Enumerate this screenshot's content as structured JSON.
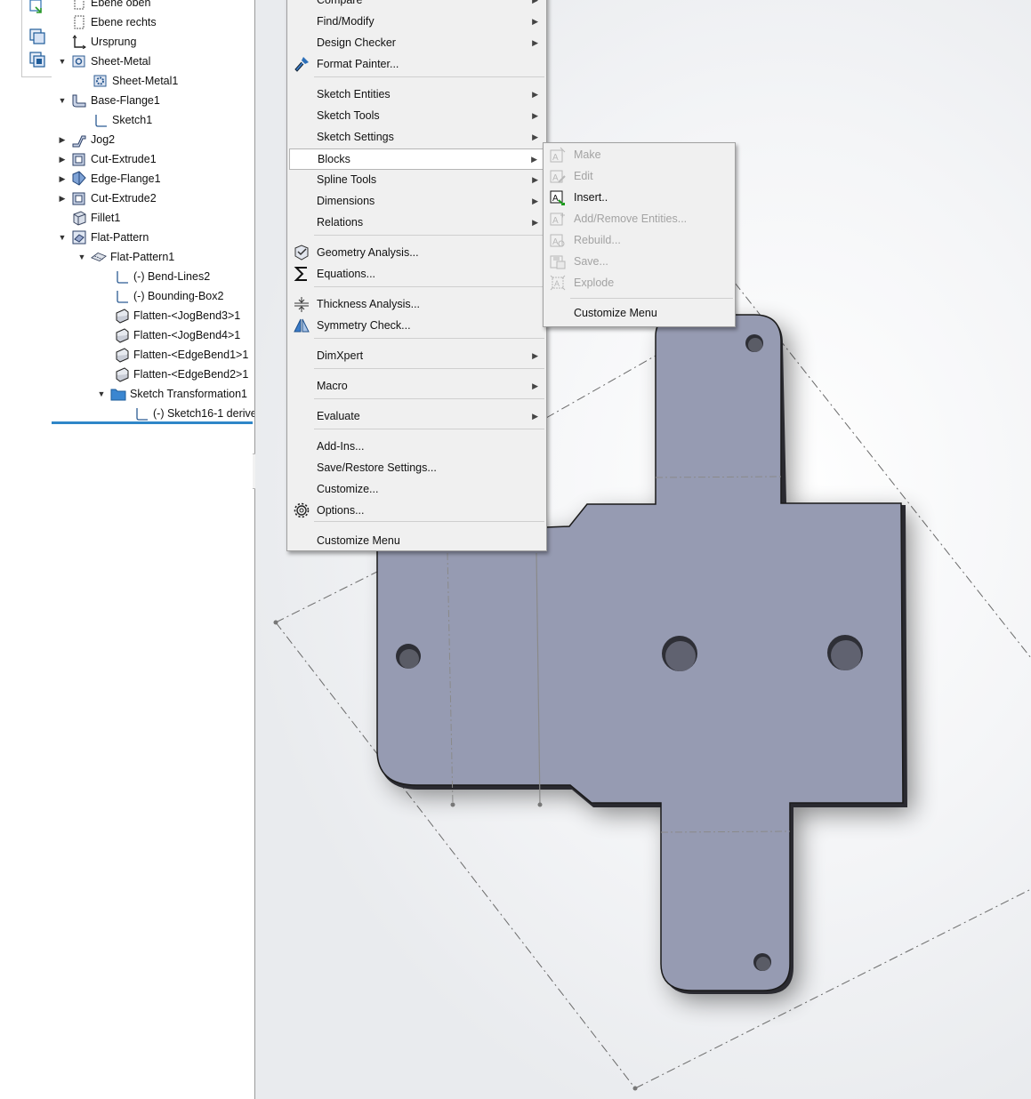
{
  "tree": {
    "items": [
      {
        "label": "Ebene oben",
        "icon": "plane-icon"
      },
      {
        "label": "Ebene rechts",
        "icon": "plane-icon"
      },
      {
        "label": "Ursprung",
        "icon": "origin-icon"
      },
      {
        "label": "Sheet-Metal",
        "icon": "sheet-metal-icon"
      },
      {
        "label": "Sheet-Metal1",
        "icon": "sheet-metal-gear-icon"
      },
      {
        "label": "Base-Flange1",
        "icon": "base-flange-icon"
      },
      {
        "label": "Sketch1",
        "icon": "sketch-icon"
      },
      {
        "label": "Jog2",
        "icon": "jog-icon"
      },
      {
        "label": "Cut-Extrude1",
        "icon": "cut-extrude-icon"
      },
      {
        "label": "Edge-Flange1",
        "icon": "edge-flange-icon"
      },
      {
        "label": "Cut-Extrude2",
        "icon": "cut-extrude-icon"
      },
      {
        "label": "Fillet1",
        "icon": "fillet-icon"
      },
      {
        "label": "Flat-Pattern",
        "icon": "flat-pattern-folder-icon"
      },
      {
        "label": "Flat-Pattern1",
        "icon": "flat-pattern-icon"
      },
      {
        "label": "(-) Bend-Lines2",
        "icon": "sketch-icon"
      },
      {
        "label": "(-) Bounding-Box2",
        "icon": "sketch-icon"
      },
      {
        "label": "Flatten-<JogBend3>1",
        "icon": "flatten-bend-icon"
      },
      {
        "label": "Flatten-<JogBend4>1",
        "icon": "flatten-bend-icon"
      },
      {
        "label": "Flatten-<EdgeBend1>1",
        "icon": "flatten-bend-icon"
      },
      {
        "label": "Flatten-<EdgeBend2>1",
        "icon": "flatten-bend-icon"
      },
      {
        "label": "Sketch Transformation1",
        "icon": "folder-icon"
      },
      {
        "label": "(-) Sketch16-1 derive",
        "icon": "sketch-icon"
      }
    ]
  },
  "menu": {
    "items": [
      {
        "label": "Compare",
        "arrow": true
      },
      {
        "label": "Find/Modify",
        "arrow": true
      },
      {
        "label": "Design Checker",
        "arrow": true
      },
      {
        "label": "Format Painter...",
        "arrow": false,
        "icon": "format-painter-icon"
      },
      {
        "label": "Sketch Entities",
        "arrow": true
      },
      {
        "label": "Sketch Tools",
        "arrow": true
      },
      {
        "label": "Sketch Settings",
        "arrow": true
      },
      {
        "label": "Blocks",
        "arrow": true
      },
      {
        "label": "Spline Tools",
        "arrow": true
      },
      {
        "label": "Dimensions",
        "arrow": true
      },
      {
        "label": "Relations",
        "arrow": true
      },
      {
        "label": "Geometry Analysis...",
        "arrow": false,
        "icon": "geometry-analysis-icon"
      },
      {
        "label": "Equations...",
        "arrow": false,
        "icon": "sigma-icon"
      },
      {
        "label": "Thickness Analysis...",
        "arrow": false,
        "icon": "thickness-analysis-icon"
      },
      {
        "label": "Symmetry Check...",
        "arrow": false,
        "icon": "symmetry-check-icon"
      },
      {
        "label": "DimXpert",
        "arrow": true
      },
      {
        "label": "Macro",
        "arrow": true
      },
      {
        "label": "Evaluate",
        "arrow": true
      },
      {
        "label": "Add-Ins...",
        "arrow": false
      },
      {
        "label": "Save/Restore Settings...",
        "arrow": false
      },
      {
        "label": "Customize...",
        "arrow": false
      },
      {
        "label": "Options...",
        "arrow": false,
        "icon": "gear-icon"
      },
      {
        "label": "Customize Menu",
        "arrow": false
      }
    ]
  },
  "submenu": {
    "items": [
      {
        "label": "Make",
        "enabled": false
      },
      {
        "label": "Edit",
        "enabled": false
      },
      {
        "label": "Insert..",
        "enabled": true
      },
      {
        "label": "Add/Remove Entities...",
        "enabled": false
      },
      {
        "label": "Rebuild...",
        "enabled": false
      },
      {
        "label": "Save...",
        "enabled": false
      },
      {
        "label": "Explode",
        "enabled": false
      },
      {
        "label": "Customize Menu",
        "enabled": true
      }
    ]
  },
  "colors": {
    "part_face": "#969bb2",
    "part_edge": "#1a1a1a",
    "menu_bg": "#f0f0f0",
    "rollback_bar": "#2f86c8"
  }
}
